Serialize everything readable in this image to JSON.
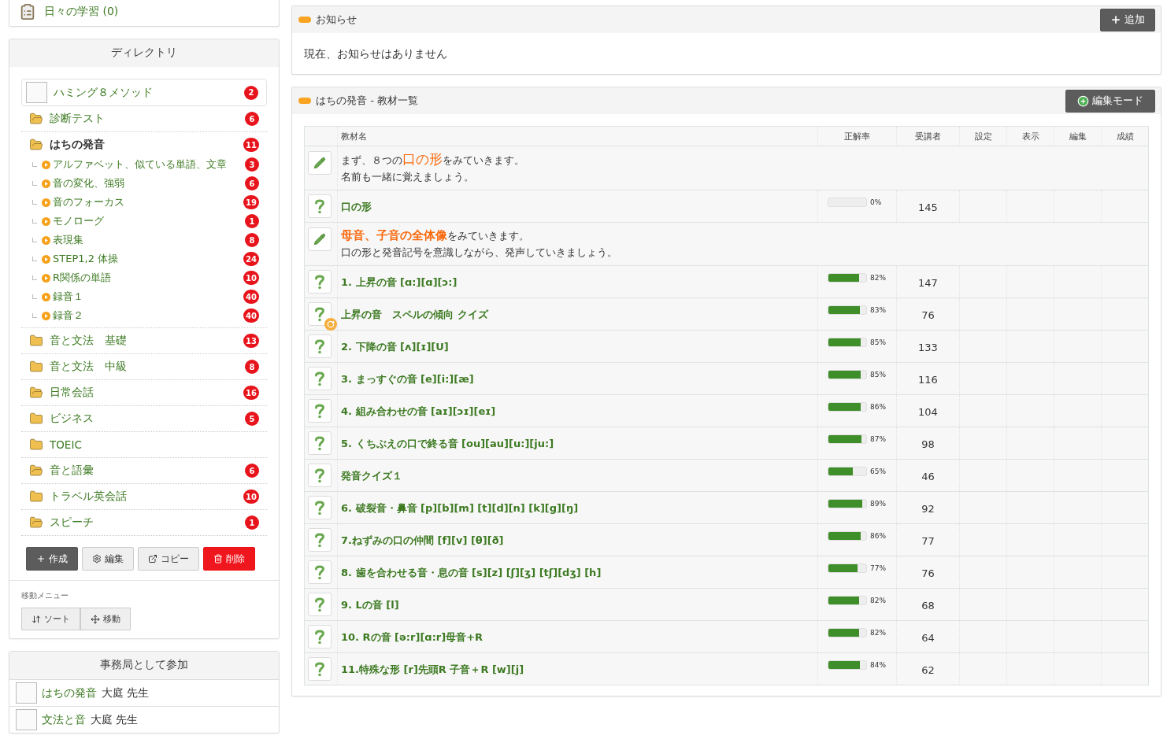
{
  "sidebar": {
    "daily_study": "日々の学習 (0)",
    "directory": {
      "title": "ディレクトリ",
      "items": [
        {
          "kind": "course",
          "label": "ハミング８メソッド",
          "badge": "2",
          "selected": false
        },
        {
          "kind": "folder",
          "label": "診断テスト",
          "badge": "6",
          "open": true,
          "selected": false
        },
        {
          "kind": "folder",
          "label": "はちの発音",
          "badge": "11",
          "open": true,
          "selected": true,
          "children": [
            {
              "label": "アルファベット、似ている単語、文章",
              "badge": "3"
            },
            {
              "label": "音の変化、強弱",
              "badge": "6"
            },
            {
              "label": "音のフォーカス",
              "badge": "19"
            },
            {
              "label": "モノローグ",
              "badge": "1"
            },
            {
              "label": "表現集",
              "badge": "8"
            },
            {
              "label": "STEP1,2 体操",
              "badge": "24"
            },
            {
              "label": "R関係の単語",
              "badge": "10"
            },
            {
              "label": "録音１",
              "badge": "40"
            },
            {
              "label": "録音２",
              "badge": "40"
            }
          ]
        },
        {
          "kind": "folder",
          "label": "音と文法　基礎",
          "badge": "13",
          "open": false,
          "selected": false
        },
        {
          "kind": "folder",
          "label": "音と文法　中級",
          "badge": "8",
          "open": false,
          "selected": false
        },
        {
          "kind": "folder",
          "label": "日常会話",
          "badge": "16",
          "open": true,
          "selected": false
        },
        {
          "kind": "folder",
          "label": "ビジネス",
          "badge": "5",
          "open": false,
          "selected": false
        },
        {
          "kind": "folder",
          "label": "TOEIC",
          "open": false,
          "selected": false
        },
        {
          "kind": "folder",
          "label": "音と語彙",
          "badge": "6",
          "open": true,
          "selected": false
        },
        {
          "kind": "folder",
          "label": "トラベル英会話",
          "badge": "10",
          "open": false,
          "selected": false
        },
        {
          "kind": "folder",
          "label": "スピーチ",
          "badge": "1",
          "open": true,
          "selected": false
        }
      ],
      "buttons": [
        {
          "kind": "create",
          "label": "作成"
        },
        {
          "kind": "edit",
          "label": "編集"
        },
        {
          "kind": "copy",
          "label": "コピー"
        },
        {
          "kind": "delete",
          "label": "削除"
        }
      ],
      "move_menu": {
        "label": "移動メニュー",
        "buttons": [
          {
            "kind": "sort",
            "label": "ソート"
          },
          {
            "kind": "move",
            "label": "移動"
          }
        ]
      }
    },
    "office": {
      "title": "事務局として参加",
      "items": [
        {
          "course": "はちの発音",
          "teacher": "大庭 先生"
        },
        {
          "course": "文法と音",
          "teacher": "大庭 先生"
        }
      ]
    }
  },
  "notice": {
    "title": "お知らせ",
    "button": "追加",
    "text": "現在、お知らせはありません"
  },
  "materials": {
    "title": "はちの発音 - 教材一覧",
    "button": "編集モード",
    "columns": [
      "教材名",
      "正解率",
      "受講者",
      "設定",
      "表示",
      "編集",
      "成績"
    ],
    "rows": [
      {
        "kind": "note",
        "highlight_bold": false,
        "lines": [
          "まず、８つの**口の形**をみていきます。",
          "名前も一緒に覚えましょう。"
        ]
      },
      {
        "kind": "quiz",
        "title": "口の形",
        "level": 0,
        "rate": "0%",
        "learners": "145",
        "refreshed": false
      },
      {
        "kind": "note",
        "highlight_bold": true,
        "lines": [
          "**母音、子音の全体像**をみていきます。",
          "口の形と発音記号を意識しながら、発声していきましょう。"
        ]
      },
      {
        "kind": "quiz",
        "title": "1. 上昇の音 [ɑ:][ɑ][ɔ:]",
        "level": 0.82,
        "rate": "82%",
        "learners": "147",
        "refreshed": false
      },
      {
        "kind": "quiz",
        "title": "上昇の音　スペルの傾向 クイズ",
        "level": 0.83,
        "rate": "83%",
        "learners": "76",
        "refreshed": true
      },
      {
        "kind": "quiz",
        "title": "2. 下降の音 [ʌ][ɪ][U]",
        "level": 0.85,
        "rate": "85%",
        "learners": "133",
        "refreshed": false
      },
      {
        "kind": "quiz",
        "title": "3. まっすぐの音 [e][i:][æ]",
        "level": 0.85,
        "rate": "85%",
        "learners": "116",
        "refreshed": false
      },
      {
        "kind": "quiz",
        "title": "4. 組み合わせの音 [aɪ][ɔɪ][eɪ]",
        "level": 0.86,
        "rate": "86%",
        "learners": "104",
        "refreshed": false
      },
      {
        "kind": "quiz",
        "title": "5. くちぶえの口で終る音 [ou][au][u:][ju:]",
        "level": 0.87,
        "rate": "87%",
        "learners": "98",
        "refreshed": false
      },
      {
        "kind": "quiz",
        "title": "発音クイズ１",
        "level": 0.65,
        "rate": "65%",
        "learners": "46",
        "refreshed": false
      },
      {
        "kind": "quiz",
        "title": "6. 破裂音・鼻音 [p][b][m] [t][d][n] [k][g][ŋ]",
        "level": 0.89,
        "rate": "89%",
        "learners": "92",
        "refreshed": false
      },
      {
        "kind": "quiz",
        "title": "7.ねずみの口の仲間 [f][v] [θ][ð]",
        "level": 0.86,
        "rate": "86%",
        "learners": "77",
        "refreshed": false
      },
      {
        "kind": "quiz",
        "title": "8. 歯を合わせる音・息の音 [s][z] [ʃ][ʒ] [tʃ][dʒ] [h]",
        "level": 0.77,
        "rate": "77%",
        "learners": "76",
        "refreshed": false
      },
      {
        "kind": "quiz",
        "title": "9. Lの音 [l]",
        "level": 0.82,
        "rate": "82%",
        "learners": "68",
        "refreshed": false
      },
      {
        "kind": "quiz",
        "title": "10. Rの音 [ə:r][ɑ:r]母音+R",
        "level": 0.82,
        "rate": "82%",
        "learners": "64",
        "refreshed": false
      },
      {
        "kind": "quiz",
        "title": "11.特殊な形 [r]先頭R 子音＋R [w][j]",
        "level": 0.84,
        "rate": "84%",
        "learners": "62",
        "refreshed": false
      }
    ]
  }
}
